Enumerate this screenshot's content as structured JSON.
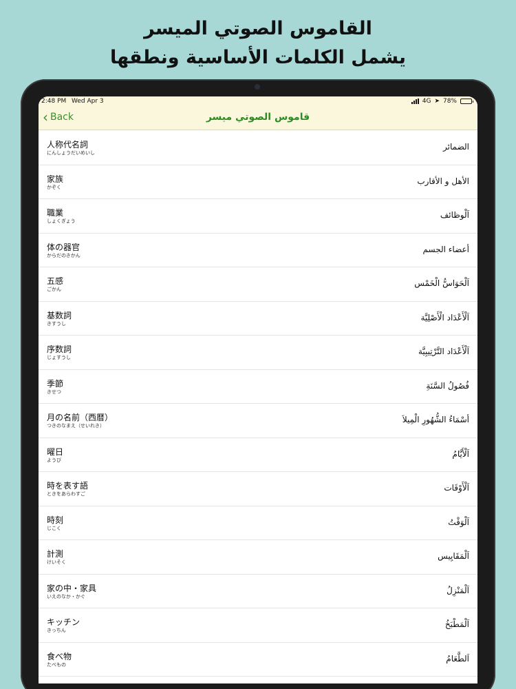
{
  "promo": {
    "line1": "القاموس الصوتي الميسر",
    "line2": "يشمل الكلمات الأساسية ونطقها"
  },
  "status_bar": {
    "time": "2:48 PM",
    "date": "Wed Apr 3",
    "network": "4G",
    "battery": "78%",
    "battery_level": 0.78
  },
  "nav": {
    "back_label": "Back",
    "title": "قاموس الصوتي ميسر"
  },
  "items": [
    {
      "jp": "人称代名詞",
      "kana": "にんしょうだいめいし",
      "ar": "الضمائر"
    },
    {
      "jp": "家族",
      "kana": "かぞく",
      "ar": "الأهل و الأقارب"
    },
    {
      "jp": "職業",
      "kana": "しょくぎょう",
      "ar": "اَلْوظائف"
    },
    {
      "jp": "体の器官",
      "kana": "からだのきかん",
      "ar": "أعضاء الجسم"
    },
    {
      "jp": "五感",
      "kana": "ごかん",
      "ar": "اَلْحَوَاسُّ الْخَمْس"
    },
    {
      "jp": "基数詞",
      "kana": "きすうし",
      "ar": "اَلْأَعْدَاد الْأَصْلِيَّة"
    },
    {
      "jp": "序数詞",
      "kana": "じょすうし",
      "ar": "اَلْأَعْدَاد التَّرْتِيبِيَّة"
    },
    {
      "jp": "季節",
      "kana": "きせつ",
      "ar": "فُصُولُ السَّنَةِ"
    },
    {
      "jp": "月の名前（西暦）",
      "kana": "つきのなまえ（せいれき）",
      "ar": "أسْمَاءُ الشُّهُورِ الْمِيلاَ"
    },
    {
      "jp": "曜日",
      "kana": "ようび",
      "ar": "اَلْأَيَّامُ"
    },
    {
      "jp": "時を表す語",
      "kana": "ときをあらわすご",
      "ar": "اَلْأَوْقَات"
    },
    {
      "jp": "時刻",
      "kana": "じこく",
      "ar": "اَلْوَقْتُ"
    },
    {
      "jp": "計測",
      "kana": "けいそく",
      "ar": "اَلْمَقَايِيس"
    },
    {
      "jp": "家の中・家具",
      "kana": "いえのなか・かぐ",
      "ar": "اَلْمَنْزِلُ"
    },
    {
      "jp": "キッチン",
      "kana": "きっちん",
      "ar": "اَلْمَطْبَخُ"
    },
    {
      "jp": "食べ物",
      "kana": "たべもの",
      "ar": "اَلطَّعَامُ"
    }
  ]
}
